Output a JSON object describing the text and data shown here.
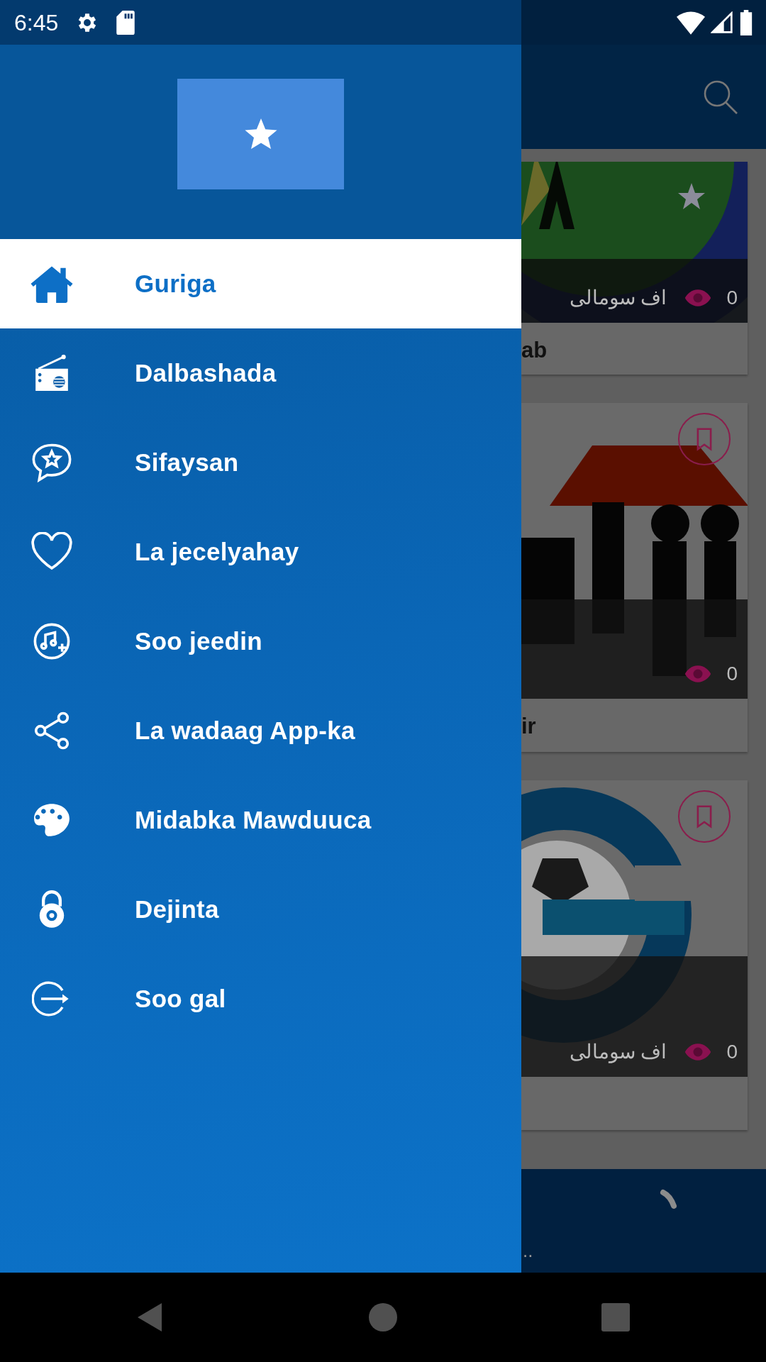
{
  "status_bar": {
    "time": "6:45"
  },
  "drawer": {
    "items": [
      {
        "label": "Guriga",
        "selected": true
      },
      {
        "label": "Dalbashada",
        "selected": false
      },
      {
        "label": "Sifaysan",
        "selected": false
      },
      {
        "label": "La jecelyahay",
        "selected": false
      },
      {
        "label": "Soo jeedin",
        "selected": false
      },
      {
        "label": "La wadaag App-ka",
        "selected": false
      },
      {
        "label": "Midabka Mawduuca",
        "selected": false
      },
      {
        "label": "Dejinta",
        "selected": false
      },
      {
        "label": "Soo gal",
        "selected": false
      }
    ]
  },
  "content": {
    "cards": [
      {
        "subtitle": "اف سومالی",
        "views": "0",
        "title": "ab",
        "bookmark": false
      },
      {
        "views": "0",
        "title": "ir",
        "bookmark": true
      },
      {
        "subtitle": "اف سومالی",
        "views": "0",
        "bookmark": true
      }
    ]
  },
  "player": {
    "text": ".."
  }
}
